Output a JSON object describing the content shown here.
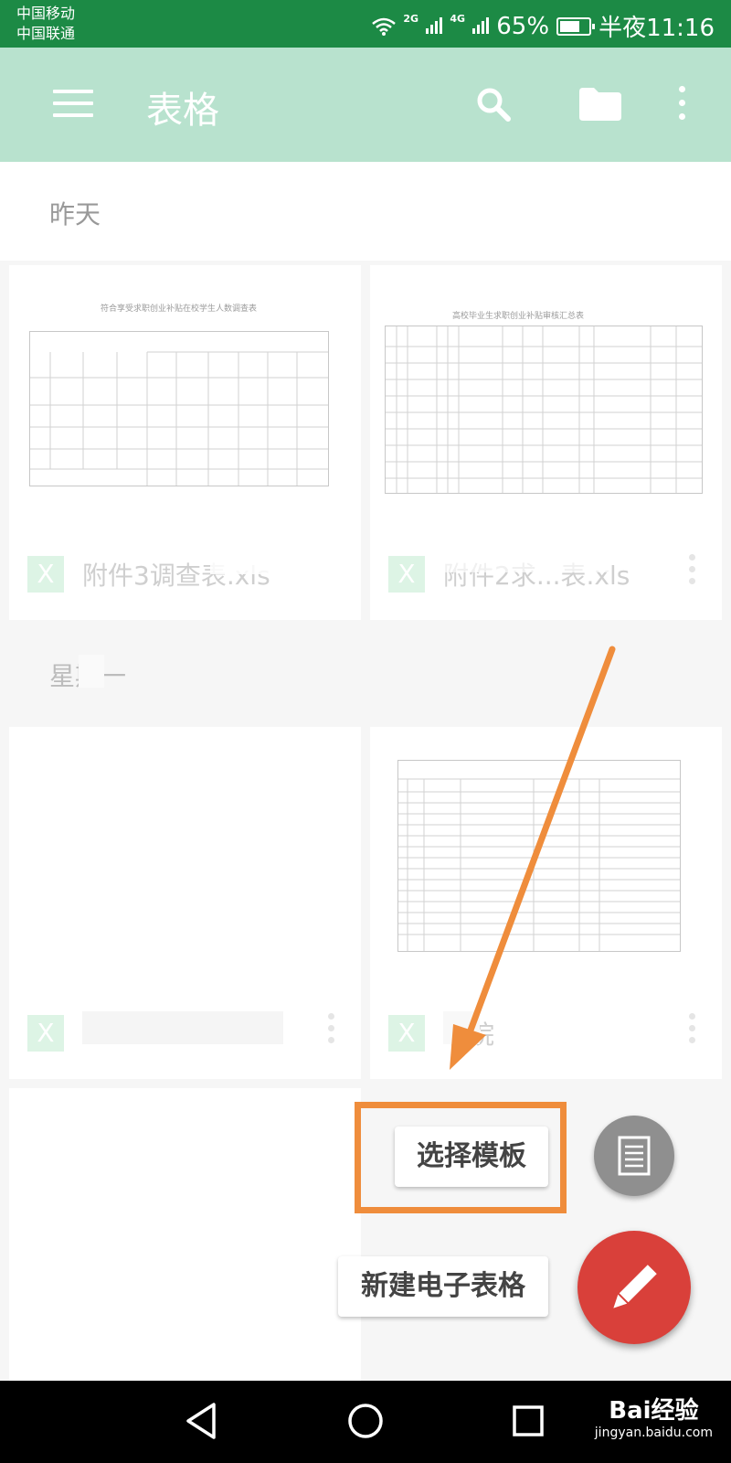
{
  "status_bar": {
    "carrier_1": "中国移动",
    "carrier_2": "中国联通",
    "net_1": "2G",
    "net_2": "4G",
    "battery": "65%",
    "time": "半夜11:16"
  },
  "app_bar": {
    "title": "表格",
    "icons": [
      "menu-icon",
      "search-icon",
      "folder-icon",
      "more-vert-icon"
    ]
  },
  "sections": [
    {
      "label": "昨天",
      "files": [
        {
          "name": "附件3调查表.xls",
          "doc_title": "符合享受求职创业补贴在校学生人数调查表"
        },
        {
          "name": "附件2求...表.xls",
          "doc_title": "高校毕业生求职创业补贴审核汇总表"
        }
      ]
    },
    {
      "label": "星期一",
      "files": [
        {
          "name": ""
        },
        {
          "name": "职院",
          "doc_title": ""
        }
      ]
    }
  ],
  "popup": {
    "select_template": "选择模板",
    "new_spreadsheet": "新建电子表格"
  },
  "watermark": {
    "brand": "Bai经验",
    "url": "jingyan.baidu.com"
  },
  "colors": {
    "status_bar": "#1c8a45",
    "app_bar": "#b8e2ce",
    "fab_red": "#d9403a",
    "highlight_orange": "#ef8d3c",
    "excel_green": "#cbeed8"
  }
}
